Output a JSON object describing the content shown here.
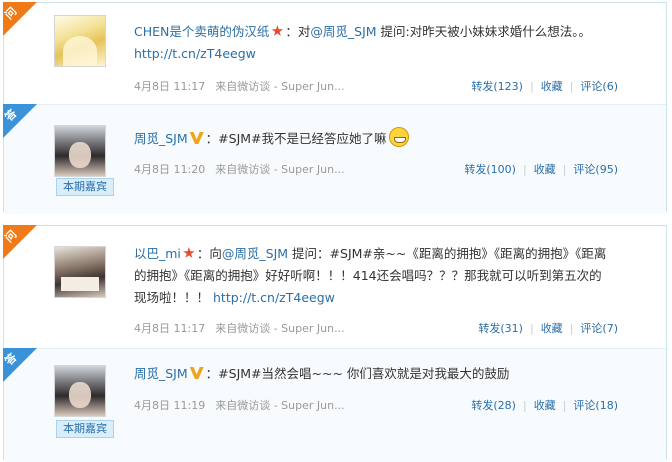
{
  "tags": {
    "question": "问",
    "answer": "答"
  },
  "guest_label": "本期嘉宾",
  "threads": [
    {
      "question": {
        "user": "CHEN是个卖萌的伪汉纸",
        "badge": "star",
        "prefix": "：对",
        "mention": "@周觅_SJM",
        "body": " 提问:对昨天被小妹妹求婚什么想法。。",
        "link": "http://t.cn/zT4eegw",
        "time": "4月8日 11:17",
        "source": "来自微访谈 - Super Jun...",
        "repost": "转发(123)",
        "fav": "收藏",
        "comment": "评论(6)"
      },
      "answer": {
        "user": "周觅_SJM",
        "badge": "v",
        "body": "：#SJM#我不是已经答应她了嘛",
        "time": "4月8日 11:20",
        "source": "来自微访谈 - Super Jun...",
        "repost": "转发(100)",
        "fav": "收藏",
        "comment": "评论(95)"
      }
    },
    {
      "question": {
        "user": "以巴_mi",
        "badge": "star",
        "prefix": "：向",
        "mention": "@周觅_SJM",
        "body": " 提问：#SJM#亲~~《距离的拥抱》《距离的拥抱》《距离的拥抱》《距离的拥抱》好好听啊！！！414还会唱吗？？？那我就可以听到第五次的现场啦！！！",
        "link": "http://t.cn/zT4eegw",
        "time": "4月8日 11:17",
        "source": "来自微访谈 - Super Jun...",
        "repost": "转发(31)",
        "fav": "收藏",
        "comment": "评论(7)"
      },
      "answer": {
        "user": "周觅_SJM",
        "badge": "v",
        "body": "：#SJM#当然会唱~~~ 你们喜欢就是对我最大的鼓励",
        "time": "4月8日 11:19",
        "source": "来自微访谈 - Super Jun...",
        "repost": "转发(28)",
        "fav": "收藏",
        "comment": "评论(18)"
      }
    }
  ]
}
